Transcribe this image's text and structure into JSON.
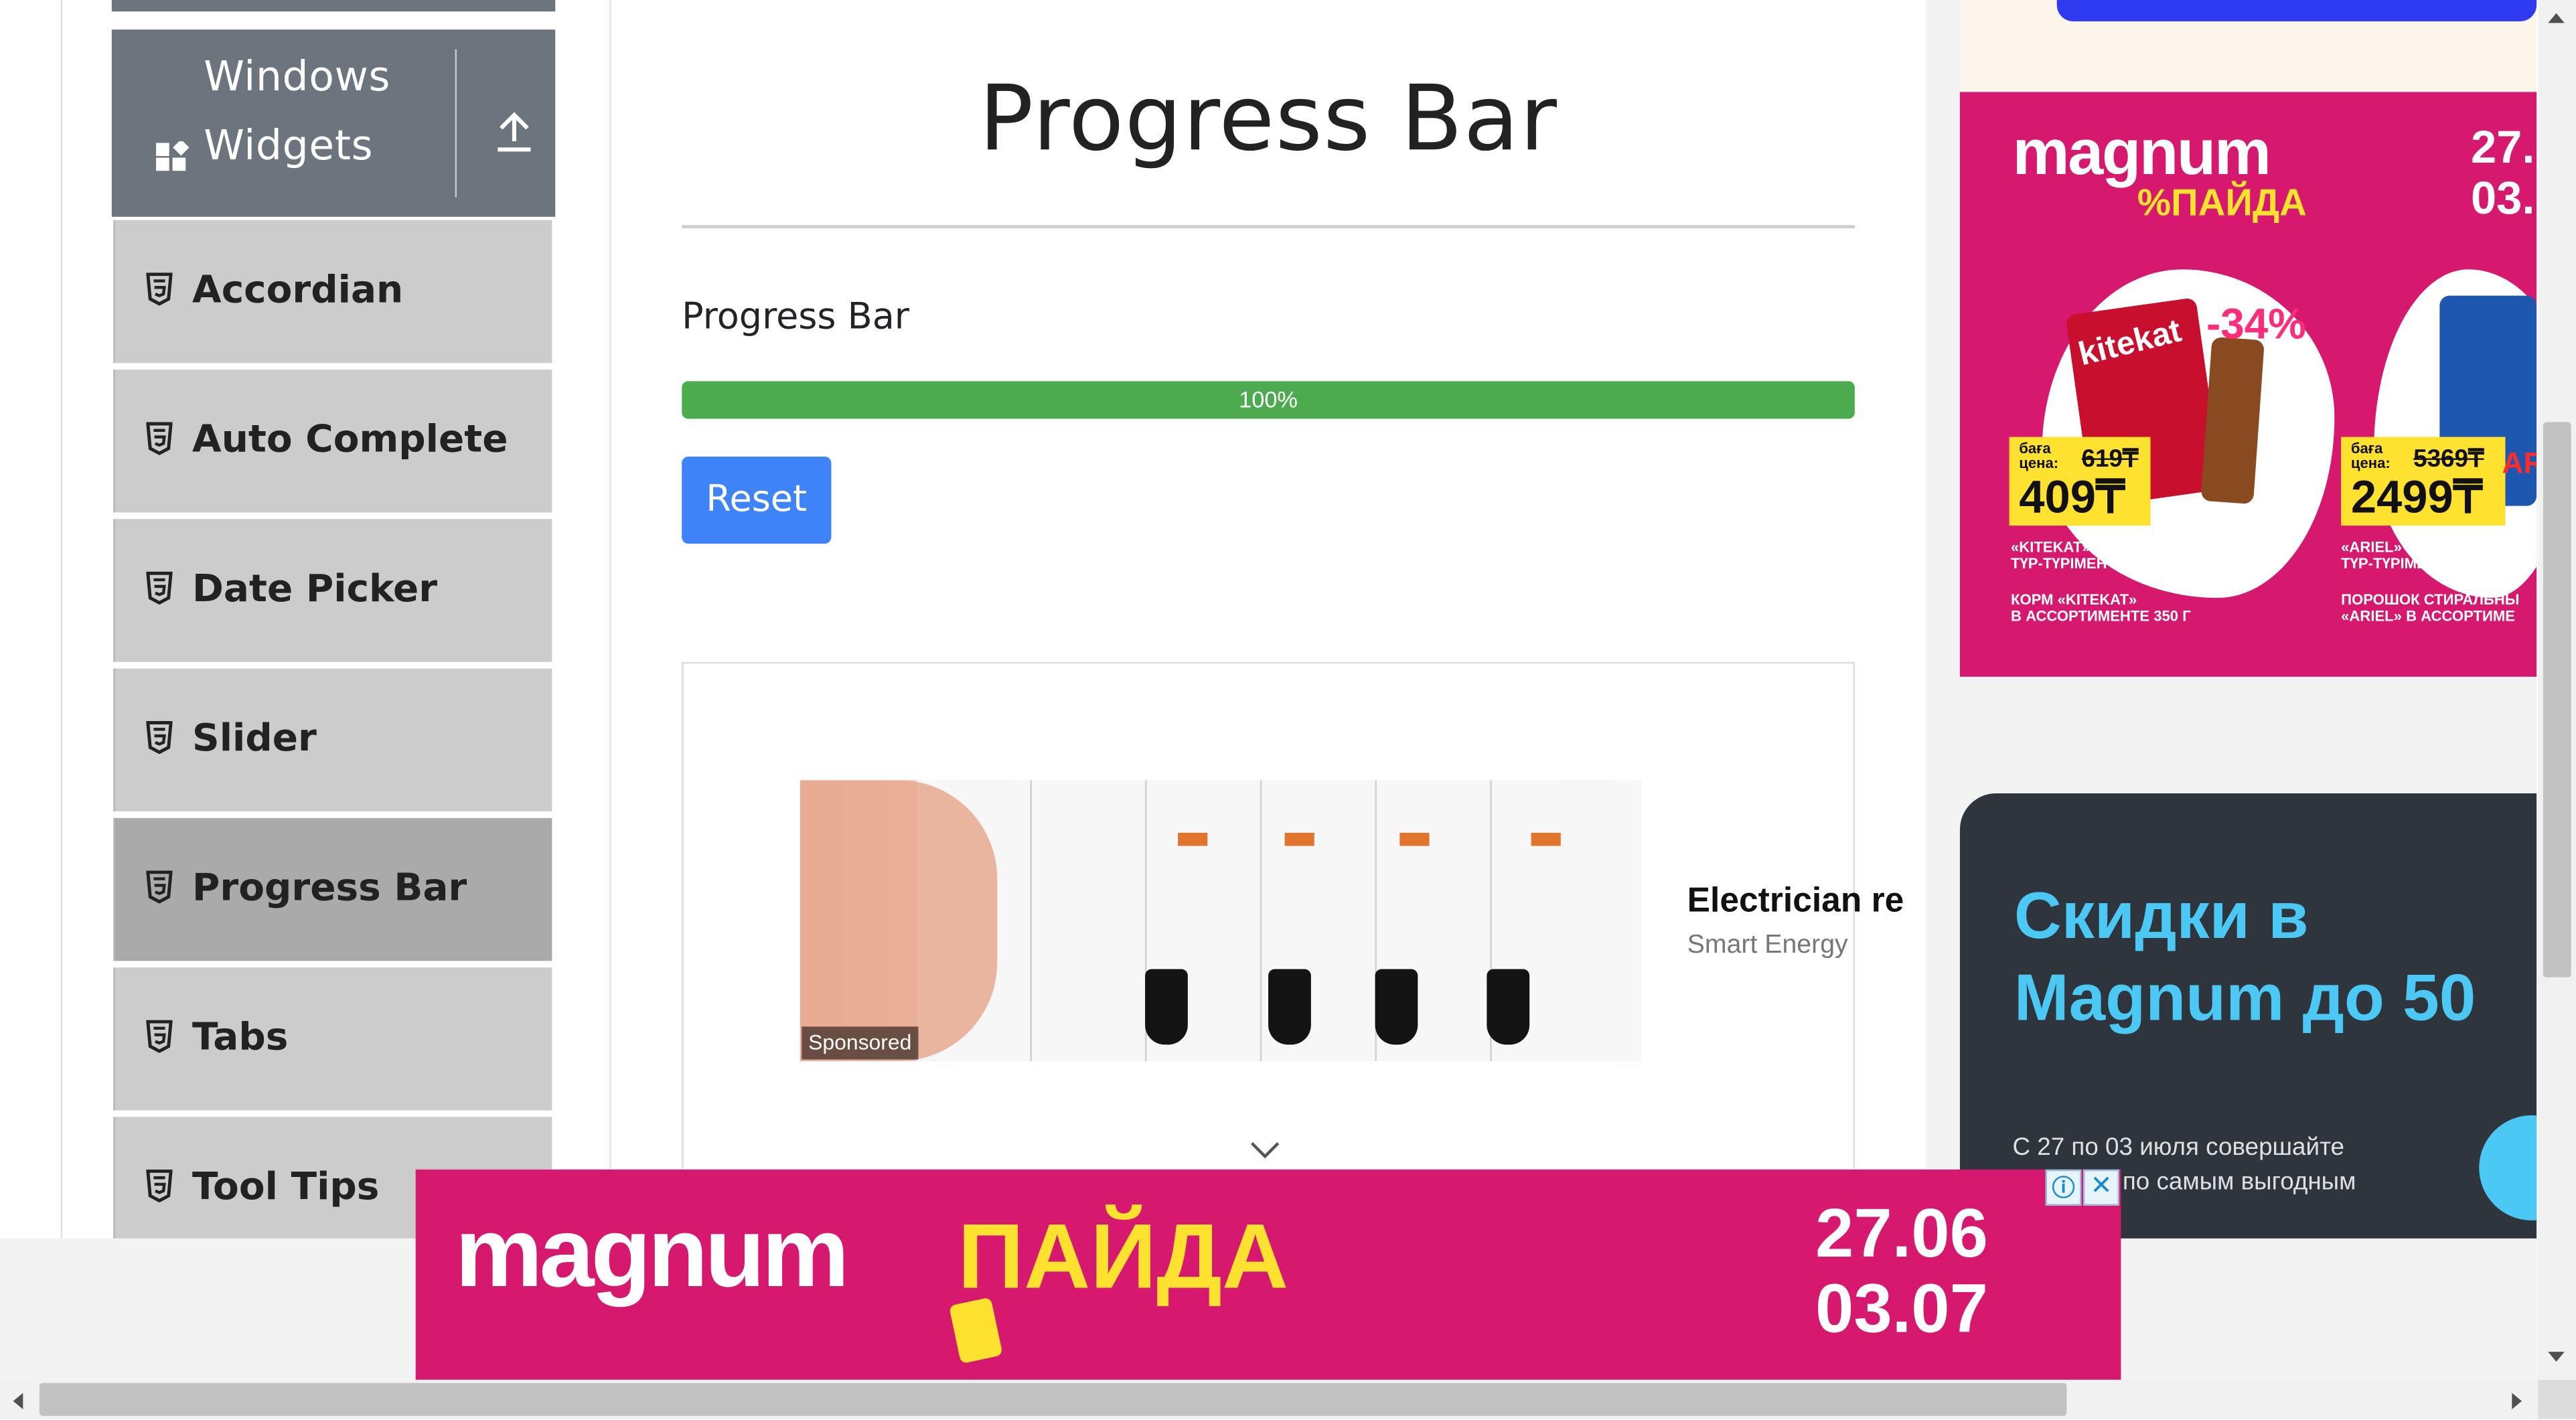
{
  "sidebar": {
    "group": {
      "line1": "Windows",
      "line2": "Widgets"
    },
    "items": [
      {
        "label": "Accordian"
      },
      {
        "label": "Auto Complete"
      },
      {
        "label": "Date Picker"
      },
      {
        "label": "Slider"
      },
      {
        "label": "Progress Bar",
        "active": true
      },
      {
        "label": "Tabs"
      },
      {
        "label": "Tool Tips"
      }
    ]
  },
  "main": {
    "page_title": "Progress Bar",
    "section_label": "Progress Bar",
    "progress": {
      "value_percent": 100,
      "label": "100%",
      "color": "#4caa4f"
    },
    "reset_label": "Reset",
    "reset_color": "#3f83f8"
  },
  "native_ad": {
    "sponsored": "Sponsored",
    "headline": "Electrician re",
    "source": "Smart Energy"
  },
  "right_ad_top": {
    "logo": "magnum",
    "logo_sub": "%ПАЙДА",
    "dates": "27.\n03.",
    "product1": {
      "discount": "-34%",
      "brand": "kitekat",
      "price_label": "баға\nцена:",
      "old_price": "619₸",
      "new_price": "409₸",
      "caption_kz": "«KITEKAT» АЗЫҒЫ\nТҮР-ТҮРІМЕН 350 Г",
      "caption_ru": "КОРМ «KITEKAT»\nВ АССОРТИМЕНТЕ 350 Г"
    },
    "product2": {
      "price_label": "баға\nцена:",
      "old_price": "5369₸",
      "new_price": "2499₸",
      "badge": "AR",
      "caption_kz": "«ARIEL» КІР ЖУҒЫШ ҰН\nТҮР-ТҮРІМЕН 3 КГ",
      "caption_ru": "ПОРОШОК СТИРАЛЬНЫ\n«ARIEL» В АССОРТИМЕ"
    },
    "brand_color": "#d6196e",
    "accent_color": "#ffe12f"
  },
  "right_ad_bottom": {
    "headline_line1": "Скидки в",
    "headline_line2": "Magnum до 50",
    "body_line1": "С 27 по 03 июля совершайте",
    "body_line2": "по самым выгодным",
    "accent_color": "#4cc8f4"
  },
  "bottom_banner": {
    "logo": "magnum",
    "logo_sub": "ПАЙДА",
    "dates_line1": "27.06",
    "dates_line2": "03.07",
    "adchoices_icon": "ⓘ",
    "close_icon": "✕"
  }
}
